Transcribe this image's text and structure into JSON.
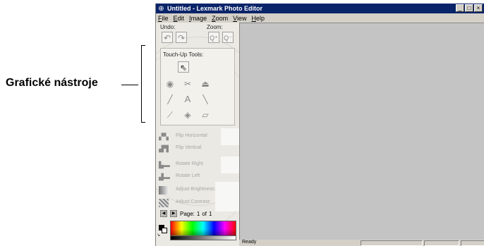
{
  "callout": {
    "label": "Grafické nástroje"
  },
  "window": {
    "title": "Untitled - Lexmark Photo Editor",
    "title_icon": "app-icon",
    "controls": [
      "minimize",
      "maximize",
      "close"
    ]
  },
  "menu": {
    "items": [
      {
        "underline": "F",
        "rest": "ile"
      },
      {
        "underline": "E",
        "rest": "dit"
      },
      {
        "underline": "I",
        "rest": "mage"
      },
      {
        "underline": "Z",
        "rest": "oom"
      },
      {
        "underline": "V",
        "rest": "iew"
      },
      {
        "underline": "H",
        "rest": "elp"
      }
    ]
  },
  "panel": {
    "undo_label": "Undo:",
    "zoom_label": "Zoom:",
    "touchup_label": "Touch-Up Tools:",
    "tools": [
      "pointer-icon",
      "red-eye-icon",
      "scissors-icon",
      "stamp-icon",
      "pen-icon",
      "text-icon",
      "line-icon",
      "dropper-icon",
      "fill-icon",
      "eraser-icon"
    ],
    "commands": {
      "flip_horizontal": "Flip Horizontal",
      "flip_vertical": "Flip Vertical",
      "rotate_right": "Rotate Right",
      "rotate_left": "Rotate Left",
      "adjust_brightness": "Adjust Brightness:",
      "adjust_contrast": "Adjust Contrast:"
    },
    "pager": {
      "page_label": "Page:",
      "page_number": "1",
      "of_label": "of",
      "total": "1"
    }
  },
  "status": {
    "text": "Ready"
  }
}
